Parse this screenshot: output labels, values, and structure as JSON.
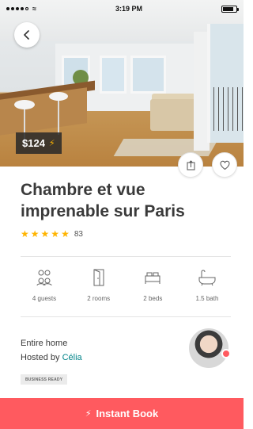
{
  "status_bar": {
    "time": "3:19 PM",
    "signal_bars": 5,
    "signal_filled": 4,
    "battery_level": 0.8
  },
  "listing": {
    "price": "$124",
    "instant_icon": "bolt-icon",
    "title": "Chambre et vue imprenable sur Paris",
    "rating_stars": 5,
    "review_count": "83"
  },
  "amenities": [
    {
      "icon": "guests-icon",
      "label": "4 guests"
    },
    {
      "icon": "rooms-icon",
      "label": "2 rooms"
    },
    {
      "icon": "beds-icon",
      "label": "2 beds"
    },
    {
      "icon": "bath-icon",
      "label": "1.5 bath"
    }
  ],
  "host": {
    "room_type": "Entire home",
    "hosted_by_prefix": "Hosted by",
    "host_name": "Célia",
    "badge": "BUSINESS READY"
  },
  "cta": {
    "label": "Instant Book"
  },
  "colors": {
    "accent": "#ff5a5f",
    "star": "#ffb400",
    "link": "#008489"
  }
}
